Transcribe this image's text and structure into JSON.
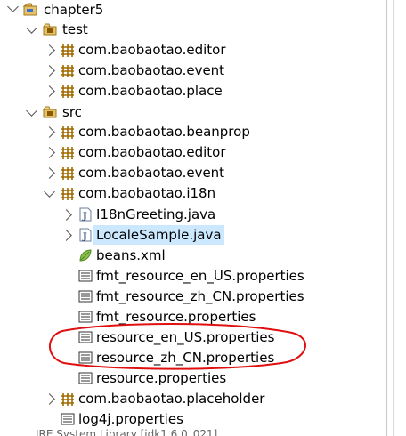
{
  "tree": {
    "project": "chapter5",
    "test_folder": "test",
    "test_packages": [
      "com.baobaotao.editor",
      "com.baobaotao.event",
      "com.baobaotao.place"
    ],
    "src_folder": "src",
    "src_packages_top": [
      "com.baobaotao.beanprop",
      "com.baobaotao.editor",
      "com.baobaotao.event"
    ],
    "i18n_package": "com.baobaotao.i18n",
    "i18n_files": [
      "I18nGreeting.java",
      "LocaleSample.java",
      "beans.xml",
      "fmt_resource_en_US.properties",
      "fmt_resource_zh_CN.properties",
      "fmt_resource.properties",
      "resource_en_US.properties",
      "resource_zh_CN.properties",
      "resource.properties"
    ],
    "placeholder_package": "com.baobaotao.placeholder",
    "log4j": "log4j.properties",
    "truncated_bottom": "JRE System Library [jdk1.6.0_021]"
  },
  "colors": {
    "selection": "#cce8ff",
    "annotation": "#e01010",
    "package": "#a06a00",
    "folder": "#e6c36a"
  }
}
